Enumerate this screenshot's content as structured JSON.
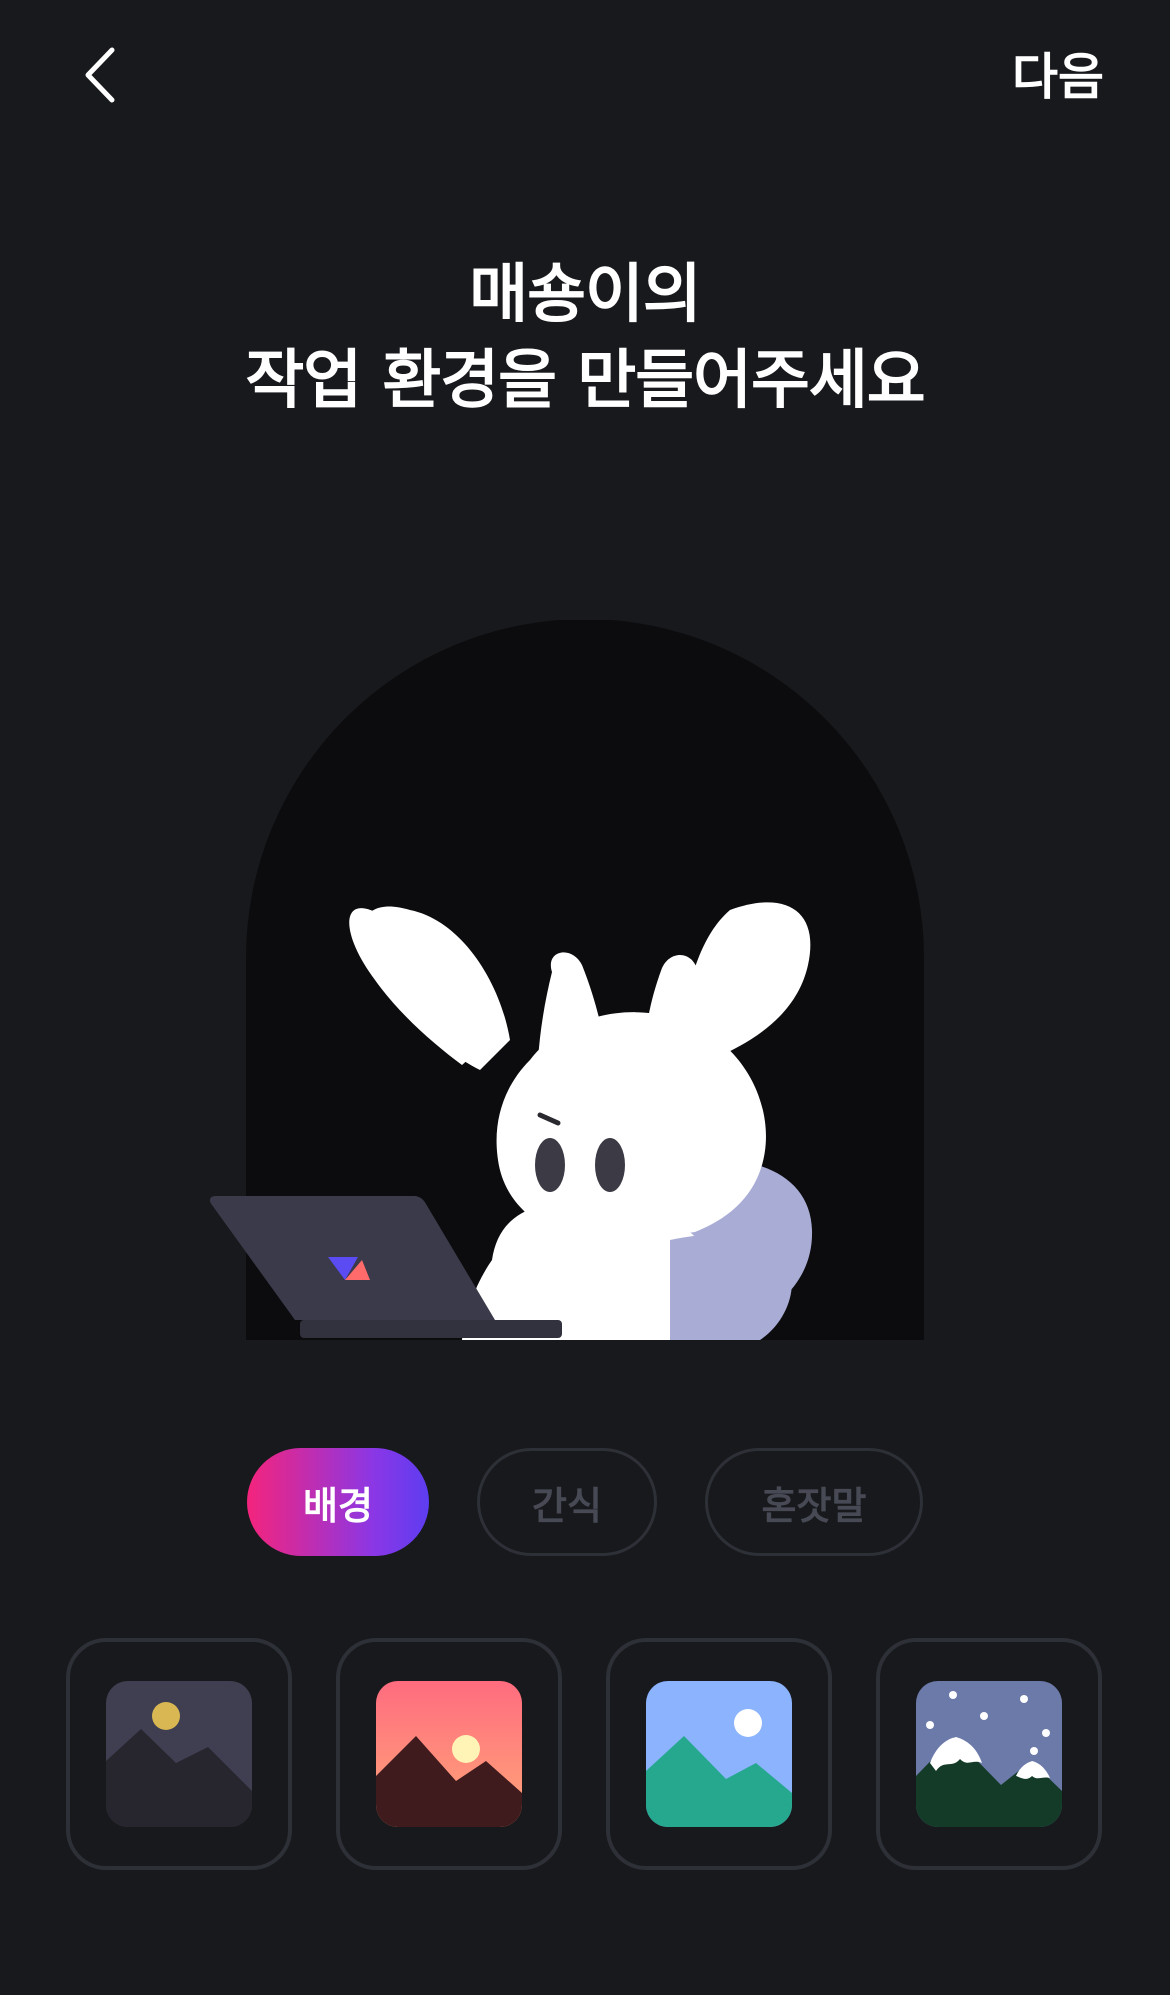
{
  "header": {
    "back_icon": "chevron-left-icon",
    "next_label": "다음"
  },
  "title": {
    "line1": "매숑이의",
    "line2": "작업 환경을 만들어주세요"
  },
  "tabs": [
    {
      "label": "배경",
      "active": true
    },
    {
      "label": "간식",
      "active": false
    },
    {
      "label": "혼잣말",
      "active": false
    }
  ],
  "backgrounds": [
    {
      "name": "night-moon-mountains",
      "sky": "#403f52",
      "mountain": "#27262f",
      "sun": "#d9b752"
    },
    {
      "name": "sunset-mountains",
      "sky": "#ff7f73",
      "mountain": "#3f1b1e",
      "sun": "#fff3b5"
    },
    {
      "name": "day-sun-mountains",
      "sky": "#8bb3fe",
      "mountain": "#25a88d",
      "sun": "#ffffff"
    },
    {
      "name": "snowy-night-mountains",
      "sky": "#6c7aa9",
      "mountain": "#133b27",
      "sun": "#ffffff"
    }
  ],
  "colors": {
    "background": "#18191c",
    "window": "#0c0c0e",
    "tab_border": "#2e3038",
    "inactive_text": "#474a55",
    "gradient_start": "#f4247c",
    "gradient_end": "#5d3df0"
  }
}
